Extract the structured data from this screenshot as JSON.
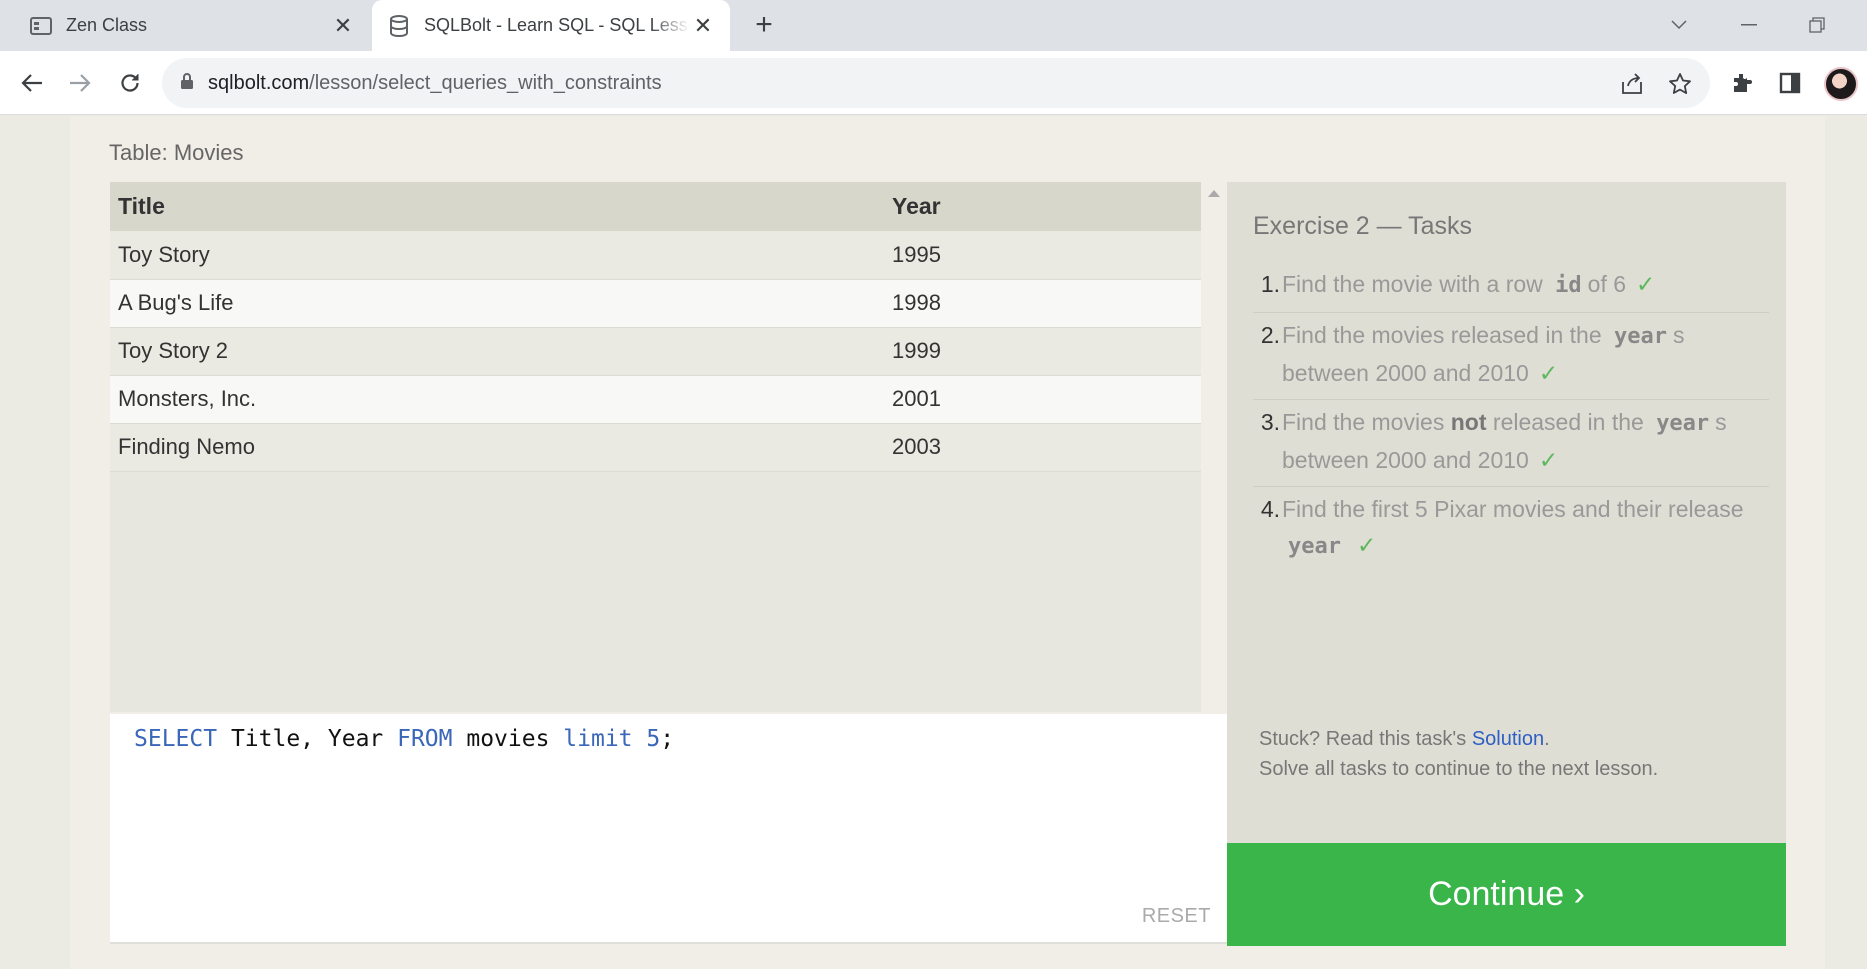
{
  "browser": {
    "tabs": [
      {
        "title": "Zen Class",
        "favicon": "zen-class-icon",
        "active": false
      },
      {
        "title": "SQLBolt - Learn SQL - SQL Lesson 2: Queries with constraints",
        "favicon": "database-icon",
        "active": true
      }
    ],
    "url": {
      "host": "sqlbolt.com",
      "path": "/lesson/select_queries_with_constraints"
    }
  },
  "lesson": {
    "table_label": "Table: Movies",
    "table": {
      "columns": [
        "Title",
        "Year"
      ],
      "rows": [
        [
          "Toy Story",
          "1995"
        ],
        [
          "A Bug's Life",
          "1998"
        ],
        [
          "Toy Story 2",
          "1999"
        ],
        [
          "Monsters, Inc.",
          "2001"
        ],
        [
          "Finding Nemo",
          "2003"
        ]
      ]
    },
    "query": {
      "tokens": [
        {
          "text": "SELECT",
          "type": "kw"
        },
        {
          "text": " Title, Year ",
          "type": "plain"
        },
        {
          "text": "FROM",
          "type": "kw"
        },
        {
          "text": " movies ",
          "type": "plain"
        },
        {
          "text": "limit",
          "type": "kw"
        },
        {
          "text": " ",
          "type": "plain"
        },
        {
          "text": "5",
          "type": "kw"
        },
        {
          "text": ";",
          "type": "plain"
        }
      ]
    },
    "reset_label": "RESET",
    "exercise": {
      "title": "Exercise 2 — Tasks",
      "tasks": [
        {
          "num": "1.",
          "before": "Find the movie with a row",
          "code": "id",
          "after": "of 6",
          "done": true
        },
        {
          "num": "2.",
          "before": "Find the movies released in the",
          "code": "year",
          "after": "s between 2000 and 2010",
          "done": true
        },
        {
          "num": "3.",
          "before": "Find the movies",
          "bold": "not",
          "middle": "released in the",
          "code": "year",
          "after": "s between 2000 and 2010",
          "done": true
        },
        {
          "num": "4.",
          "before": "Find the first 5 Pixar movies and their release",
          "code": "year",
          "after": "",
          "done": true
        }
      ],
      "check_mark": "✓",
      "stuck_prefix": "Stuck? Read this task's ",
      "solution_link": "Solution",
      "stuck_suffix": ".",
      "solve_all": "Solve all tasks to continue to the next lesson."
    },
    "continue_label": "Continue ›"
  }
}
